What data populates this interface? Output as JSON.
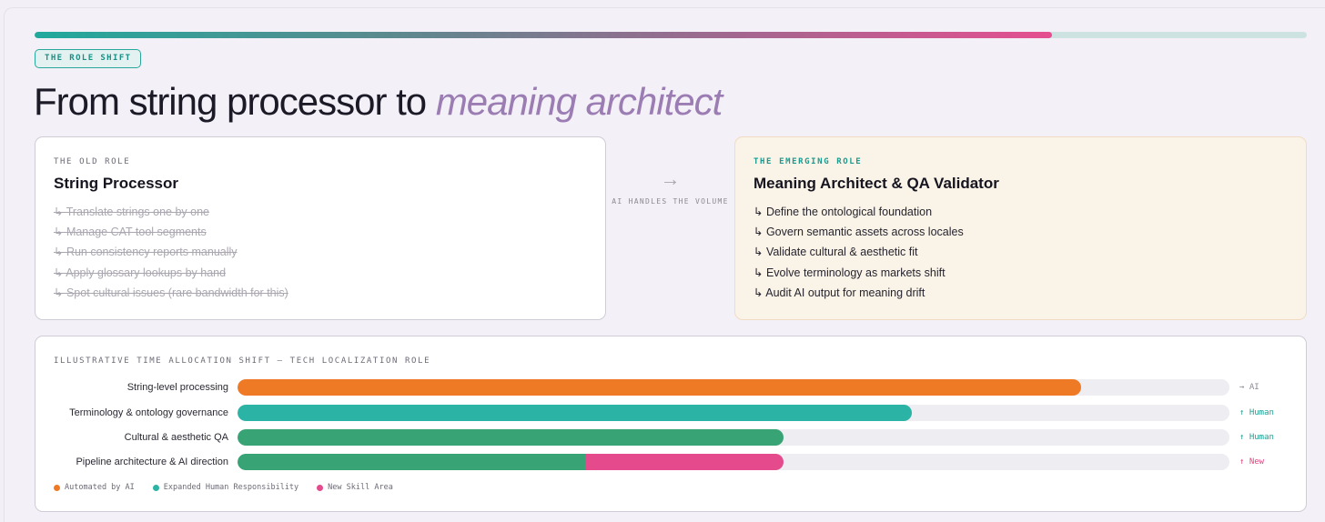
{
  "progress": {
    "value": 0.8
  },
  "badge": "THE ROLE SHIFT",
  "headline": {
    "main": "From string processor to ",
    "accent": "meaning architect"
  },
  "old_role": {
    "eyebrow": "THE OLD ROLE",
    "title": "String Processor",
    "items": [
      "↳ Translate strings one by one",
      "↳ Manage CAT tool segments",
      "↳ Run consistency reports manually",
      "↳ Apply glossary lookups by hand",
      "↳ Spot cultural issues (rare bandwidth for this)"
    ]
  },
  "transition": {
    "arrow": "→",
    "label": "AI HANDLES THE VOLUME"
  },
  "new_role": {
    "eyebrow": "THE EMERGING ROLE",
    "title": "Meaning Architect & QA Validator",
    "items": [
      "↳ Define the ontological foundation",
      "↳ Govern semantic assets across locales",
      "↳ Validate cultural & aesthetic fit",
      "↳ Evolve terminology as markets shift",
      "↳ Audit AI output for meaning drift"
    ]
  },
  "chart_data": {
    "type": "bar",
    "title": "ILLUSTRATIVE TIME ALLOCATION SHIFT — TECH LOCALIZATION ROLE",
    "stacked": true,
    "orientation": "horizontal",
    "xlim": [
      0,
      100
    ],
    "categories": [
      "String-level processing",
      "Terminology & ontology governance",
      "Cultural & aesthetic QA",
      "Pipeline architecture & AI direction"
    ],
    "series": [
      {
        "name": "Automated by AI",
        "color": "#ee7a26",
        "values": [
          85,
          0,
          0,
          0
        ]
      },
      {
        "name": "Expanded Human Responsibility",
        "color": "#2bb3a6",
        "values": [
          0,
          68,
          55,
          35
        ]
      },
      {
        "name": "New Skill Area",
        "color": "#e44a8c",
        "values": [
          0,
          0,
          0,
          20
        ]
      }
    ],
    "segment_colors": [
      [
        "#ee7a26"
      ],
      [
        "#2bb3a6"
      ],
      [
        "#38a374"
      ],
      [
        "#38a374",
        "#e44a8c"
      ]
    ],
    "tags": [
      {
        "text": "→ AI",
        "color": "#8c8993"
      },
      {
        "text": "↑ Human",
        "color": "#1e9e91"
      },
      {
        "text": "↑ Human",
        "color": "#1e9e91"
      },
      {
        "text": "↑ New",
        "color": "#e0447f"
      }
    ],
    "legend": [
      {
        "label": "Automated by AI",
        "color": "#ee7a26"
      },
      {
        "label": "Expanded Human Responsibility",
        "color": "#2bb3a6"
      },
      {
        "label": "New Skill Area",
        "color": "#e44a8c"
      }
    ],
    "legend_position": "bottom-left"
  }
}
